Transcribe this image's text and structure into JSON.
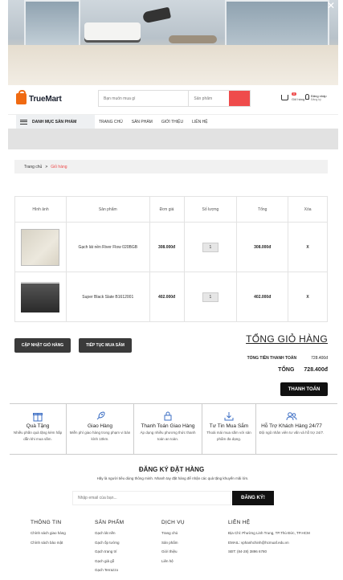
{
  "brand": {
    "name": "TrueMart"
  },
  "search": {
    "query_placeholder": "Bạn muốn mua gì",
    "category_placeholder": "Sản phẩm"
  },
  "header": {
    "cart_badge": "0",
    "cart_label": "Giỏ hàng",
    "login_label": "Đăng nhập",
    "register_label": "Đăng ký"
  },
  "nav": {
    "category_menu": "DANH MỤC SẢN PHẨM",
    "links": [
      "TRANG CHỦ",
      "SẢN PHẨM",
      "GIỚI THIỆU",
      "LIÊN HỆ"
    ]
  },
  "breadcrumb": {
    "home": "Trang chủ",
    "separator": ">",
    "current": "Giỏ hàng"
  },
  "table": {
    "headers": [
      "Hình ảnh",
      "Sản phẩm",
      "Đơn giá",
      "Số lượng",
      "Tổng",
      "Xóa"
    ],
    "rows": [
      {
        "name": "Gạch lát nền River Flow 020BGB",
        "price": "308.000đ",
        "qty": "1",
        "total": "308.000đ",
        "delete": "X"
      },
      {
        "name": "Super Black Slate B1612001",
        "price": "402.000đ",
        "qty": "1",
        "total": "402.000đ",
        "delete": "X"
      }
    ]
  },
  "actions": {
    "update": "CẬP NHẬT GIỎ HÀNG",
    "continue": "TIẾP TỤC MUA SẮM"
  },
  "totals": {
    "title": "TỔNG GIỎ HÀNG",
    "subtotal_label": "TỔNG TIỀN THANH TOÁN",
    "subtotal_value": "728.400đ",
    "total_label": "TỔNG",
    "total_value": "728.400đ",
    "checkout": "THANH TOÁN"
  },
  "features": [
    {
      "title": "Quà Tặng",
      "desc": "Nhiều phần quà tặng kèm hấp dẫn khi mua sắm."
    },
    {
      "title": "Giao Hàng",
      "desc": "Miễn phí giao hàng trong phạm vi bán kính 10km."
    },
    {
      "title": "Thanh Toán Giao Hàng",
      "desc": "Áp dụng nhiều phương thức thanh toán an toàn."
    },
    {
      "title": "Tư Tin Mua Sắm",
      "desc": "Thoải mái mua sắm với sản phẩm đa dạng."
    },
    {
      "title": "Hỗ Trợ Khách Hàng 24/77",
      "desc": "Đội ngũ nhân viên tư vấn và hỗ trợ 24/7."
    }
  ],
  "subscribe": {
    "title": "ĐĂNG KÝ ĐẶT HÀNG",
    "desc": "Hãy là người tiêu dùng thông minh. Nhanh tay đặt hàng để nhận các quà tặng khuyến mãi lớn.",
    "placeholder": "Nhập email của bạn...",
    "button": "ĐĂNG KÝ!"
  },
  "footer": {
    "info": {
      "title": "THÔNG TIN",
      "items": [
        "Chính sách giao hàng",
        "Chính sách bảo mật"
      ]
    },
    "products": {
      "title": "SẢN PHẨM",
      "items": [
        "Gạch lát nền",
        "Gạch ốp tường",
        "Gạch trang trí",
        "Gạch giả gỗ",
        "Gạch Terrazzo"
      ]
    },
    "services": {
      "title": "DỊCH VỤ",
      "items": [
        "Trang chủ",
        "Sản phẩm",
        "Giới thiệu",
        "Liên hệ"
      ]
    },
    "contact": {
      "title": "LIÊN HỆ",
      "items": [
        "Địa Chỉ: Phường Linh Trung, TP.Thủ Đức, TP.HCM",
        "EMAIL: vphanhchinh@hcmuaf.edu.vn",
        "SĐT: (84-28) 3896 6780"
      ]
    }
  },
  "colors": {
    "accent": "#ef4b4b",
    "brand": "#f06a12",
    "dark": "#111111"
  },
  "icons": [
    "close-icon",
    "truemart-bag-icon",
    "cart-icon",
    "user-icon",
    "menu-icon",
    "gift-icon",
    "rocket-icon",
    "lock-icon",
    "download-icon",
    "support-icon"
  ]
}
